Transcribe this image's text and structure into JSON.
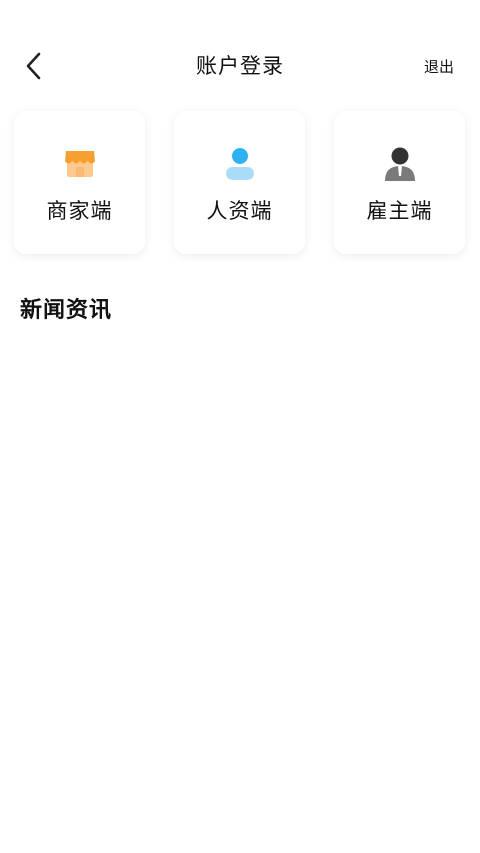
{
  "header": {
    "title": "账户登录",
    "logout_label": "退出",
    "back_icon": "chevron-left-icon"
  },
  "cards": [
    {
      "label": "商家端",
      "icon": "store-icon",
      "color": "#F7A030"
    },
    {
      "label": "人资端",
      "icon": "person-icon",
      "color": "#2FB2F0"
    },
    {
      "label": "雇主端",
      "icon": "employer-icon",
      "color": "#333333"
    }
  ],
  "news": {
    "title": "新闻资讯"
  }
}
